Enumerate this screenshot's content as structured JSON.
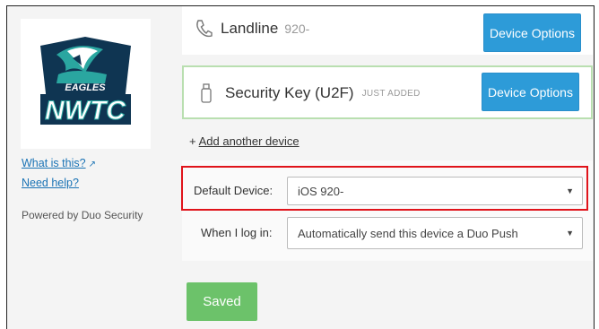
{
  "sidebar": {
    "logo_text": "NWTC",
    "logo_subtext": "EAGLES",
    "what_is_this": "What is this?",
    "need_help": "Need help?",
    "powered_by": "Powered by Duo Security"
  },
  "devices": [
    {
      "name": "Landline",
      "number": "920-",
      "button": "Device Options",
      "icon": "phone-icon"
    },
    {
      "name": "Security Key (U2F)",
      "badge": "JUST ADDED",
      "button": "Device Options",
      "icon": "usb-key-icon"
    }
  ],
  "add_device": {
    "plus": "+",
    "label": "Add another device"
  },
  "settings": {
    "default_device_label": "Default Device:",
    "default_device_value": "iOS 920-",
    "login_label": "When I log in:",
    "login_value": "Automatically send this device a Duo Push"
  },
  "save_button": "Saved",
  "colors": {
    "primary_blue": "#2d9bd8",
    "success_green": "#6cc26a",
    "highlight_red": "#e0141b",
    "link_blue": "#1a73b5"
  }
}
